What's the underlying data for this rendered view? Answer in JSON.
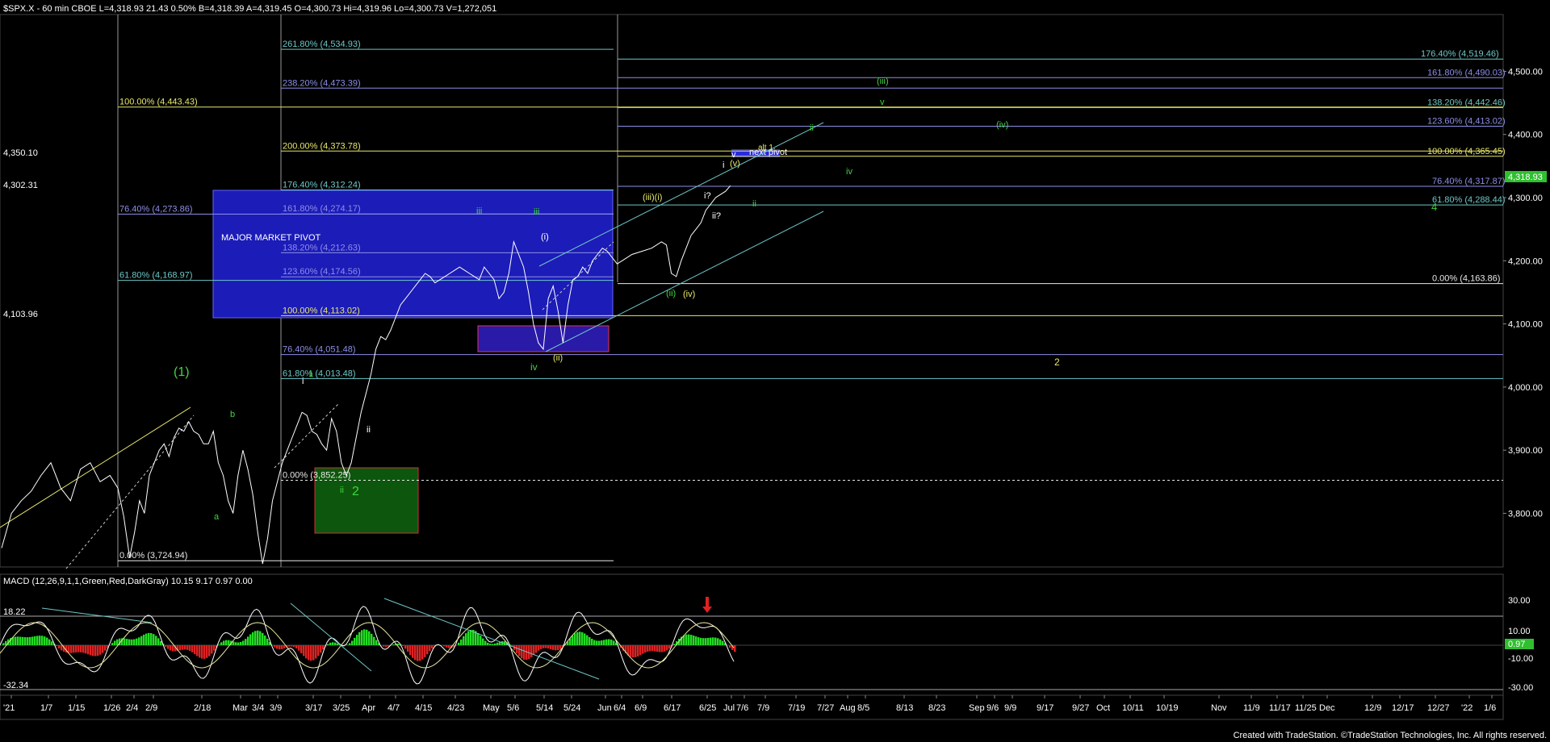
{
  "header": {
    "title": "$SPX.X - 60 min  CBOE  L=4,318.93  21.43  0.50%  B=4,318.39  A=4,319.45  O=4,300.73  Hi=4,319.96  Lo=4,300.73  V=1,272,051"
  },
  "footer": {
    "credit": "Created with TradeStation. ©TradeStation Technologies, Inc. All rights reserved."
  },
  "macd": {
    "header": "MACD (12,26,9,1,1,Green,Red,DarkGray)   10.15   9.17   0.97   0.00",
    "left_top": "18.22",
    "left_bottom": "-32.34",
    "current": "0.97",
    "ticks": [
      "30.00",
      "10.00",
      "-10.00",
      "-30.00"
    ],
    "colors": {
      "positive": "#22dd22",
      "negative": "#dd2222",
      "line": "#ffffff",
      "signal": "#e8e8a0"
    }
  },
  "colors": {
    "background": "#000000",
    "price": "#ffffff",
    "fib_yellow": "#e8e86a",
    "fib_blue": "#8e8ee8",
    "fib_teal": "#6ec7c7",
    "wave_green": "#3fd63f",
    "wave_yellow": "#e8e86a",
    "pivot_box": "#2020c0",
    "support_box": "#0f6a0f",
    "current_price_bg": "#2fbf2f"
  },
  "annotations": {
    "major_pivot": "MAJOR MARKET PIVOT",
    "next_pivot": "next pivot",
    "left_price_a": "4,350.10",
    "left_price_b": "4,302.31",
    "left_price_c": "4,103.96",
    "current_price": "4,318.93"
  },
  "chart_data": {
    "type": "line",
    "title": "$SPX.X - 60 min",
    "xlabel": "",
    "ylabel": "",
    "ylim": [
      3715,
      4590
    ],
    "grid": false,
    "x_ticks": [
      "'21",
      "1/7",
      "1/15",
      "1/26",
      "2/4",
      "2/9",
      "2/18",
      "Mar",
      "3/4",
      "3/9",
      "3/17",
      "3/25",
      "Apr",
      "4/7",
      "4/15",
      "4/23",
      "May",
      "5/6",
      "5/14",
      "5/24",
      "Jun",
      "6/4",
      "6/9",
      "6/17",
      "6/25",
      "Jul",
      "7/6",
      "7/9",
      "7/19",
      "7/27",
      "Aug",
      "8/5",
      "8/13",
      "8/23",
      "Sep",
      "9/6",
      "9/9",
      "9/17",
      "9/27",
      "Oct",
      "10/11",
      "10/19",
      "Nov",
      "11/9",
      "11/17",
      "11/25",
      "Dec",
      "12/9",
      "12/17",
      "12/27",
      "'22",
      "1/6"
    ],
    "y_ticks": [
      "4,500.00",
      "4,400.00",
      "4,300.00",
      "4,200.00",
      "4,100.00",
      "4,000.00",
      "3,900.00",
      "3,800.00"
    ],
    "price_series": {
      "name": "",
      "points": [
        [
          0,
          3745
        ],
        [
          10,
          3800
        ],
        [
          20,
          3820
        ],
        [
          30,
          3835
        ],
        [
          40,
          3860
        ],
        [
          50,
          3880
        ],
        [
          60,
          3840
        ],
        [
          70,
          3820
        ],
        [
          80,
          3870
        ],
        [
          90,
          3880
        ],
        [
          100,
          3850
        ],
        [
          110,
          3860
        ],
        [
          118,
          3840
        ],
        [
          124,
          3795
        ],
        [
          130,
          3730
        ],
        [
          135,
          3770
        ],
        [
          140,
          3820
        ],
        [
          145,
          3800
        ],
        [
          150,
          3860
        ],
        [
          155,
          3880
        ],
        [
          160,
          3900
        ],
        [
          165,
          3910
        ],
        [
          170,
          3890
        ],
        [
          175,
          3920
        ],
        [
          180,
          3935
        ],
        [
          185,
          3930
        ],
        [
          190,
          3945
        ],
        [
          195,
          3930
        ],
        [
          200,
          3925
        ],
        [
          205,
          3910
        ],
        [
          210,
          3910
        ],
        [
          215,
          3930
        ],
        [
          220,
          3880
        ],
        [
          225,
          3860
        ],
        [
          230,
          3820
        ],
        [
          235,
          3800
        ],
        [
          240,
          3860
        ],
        [
          245,
          3900
        ],
        [
          250,
          3870
        ],
        [
          255,
          3830
        ],
        [
          260,
          3770
        ],
        [
          265,
          3720
        ],
        [
          270,
          3760
        ],
        [
          275,
          3820
        ],
        [
          280,
          3850
        ],
        [
          285,
          3880
        ],
        [
          290,
          3900
        ],
        [
          295,
          3920
        ],
        [
          300,
          3940
        ],
        [
          305,
          3960
        ],
        [
          310,
          3955
        ],
        [
          315,
          3930
        ],
        [
          320,
          3925
        ],
        [
          325,
          3910
        ],
        [
          330,
          3900
        ],
        [
          335,
          3950
        ],
        [
          340,
          3930
        ],
        [
          345,
          3880
        ],
        [
          350,
          3860
        ],
        [
          355,
          3880
        ],
        [
          360,
          3920
        ],
        [
          365,
          3960
        ],
        [
          370,
          3990
        ],
        [
          375,
          4020
        ],
        [
          380,
          4060
        ],
        [
          385,
          4080
        ],
        [
          390,
          4075
        ],
        [
          395,
          4090
        ],
        [
          400,
          4110
        ],
        [
          405,
          4130
        ],
        [
          410,
          4140
        ],
        [
          415,
          4150
        ],
        [
          420,
          4160
        ],
        [
          425,
          4170
        ],
        [
          430,
          4180
        ],
        [
          435,
          4175
        ],
        [
          440,
          4165
        ],
        [
          445,
          4170
        ],
        [
          450,
          4175
        ],
        [
          455,
          4180
        ],
        [
          460,
          4185
        ],
        [
          465,
          4190
        ],
        [
          470,
          4185
        ],
        [
          475,
          4180
        ],
        [
          480,
          4175
        ],
        [
          485,
          4170
        ],
        [
          490,
          4190
        ],
        [
          495,
          4180
        ],
        [
          500,
          4170
        ],
        [
          505,
          4140
        ],
        [
          510,
          4150
        ],
        [
          515,
          4180
        ],
        [
          520,
          4230
        ],
        [
          525,
          4210
        ],
        [
          530,
          4190
        ],
        [
          535,
          4150
        ],
        [
          540,
          4100
        ],
        [
          545,
          4070
        ],
        [
          550,
          4060
        ],
        [
          555,
          4140
        ],
        [
          560,
          4160
        ],
        [
          565,
          4120
        ],
        [
          570,
          4070
        ],
        [
          575,
          4130
        ],
        [
          580,
          4170
        ],
        [
          585,
          4175
        ],
        [
          590,
          4190
        ],
        [
          595,
          4180
        ],
        [
          600,
          4200
        ],
        [
          605,
          4210
        ],
        [
          610,
          4220
        ],
        [
          615,
          4215
        ],
        [
          620,
          4205
        ],
        [
          625,
          4195
        ],
        [
          630,
          4200
        ],
        [
          640,
          4210
        ],
        [
          650,
          4215
        ],
        [
          660,
          4220
        ],
        [
          670,
          4230
        ],
        [
          675,
          4225
        ],
        [
          680,
          4180
        ],
        [
          685,
          4175
        ],
        [
          690,
          4200
        ],
        [
          695,
          4220
        ],
        [
          700,
          4240
        ],
        [
          705,
          4250
        ],
        [
          710,
          4260
        ],
        [
          715,
          4280
        ],
        [
          720,
          4290
        ],
        [
          725,
          4300
        ],
        [
          730,
          4305
        ],
        [
          735,
          4310
        ],
        [
          740,
          4319
        ]
      ]
    },
    "fib_levels": [
      {
        "label": "261.80% (4,534.93)",
        "value": 4534.93,
        "color": "#6ec7c7"
      },
      {
        "label": "238.20% (4,473.39)",
        "value": 4473.39,
        "color": "#8e8ee8"
      },
      {
        "label": "100.00% (4,443.43)",
        "value": 4443.43,
        "color": "#e8e86a"
      },
      {
        "label": "200.00% (4,373.78)",
        "value": 4373.78,
        "color": "#e8e86a"
      },
      {
        "label": "176.40% (4,312.24)",
        "value": 4312.24,
        "color": "#6ec7c7"
      },
      {
        "label": "76.40% (4,273.86)",
        "value": 4273.86,
        "color": "#8e8ee8"
      },
      {
        "label": "161.80% (4,274.17)",
        "value": 4274.17,
        "color": "#8e8ee8"
      },
      {
        "label": "138.20% (4,212.63)",
        "value": 4212.63,
        "color": "#8e8ee8"
      },
      {
        "label": "123.60% (4,174.56)",
        "value": 4174.56,
        "color": "#8e8ee8"
      },
      {
        "label": "61.80% (4,168.97)",
        "value": 4168.97,
        "color": "#6ec7c7"
      },
      {
        "label": "100.00% (4,113.02)",
        "value": 4113.02,
        "color": "#e8e86a"
      },
      {
        "label": "76.40% (4,051.48)",
        "value": 4051.48,
        "color": "#8e8ee8"
      },
      {
        "label": "61.80% (4,013.48)",
        "value": 4013.48,
        "color": "#6ec7c7"
      },
      {
        "label": "0.00% (3,852.25)",
        "value": 3852.25,
        "color": "#e8e8e8"
      },
      {
        "label": "0.00% (3,724.94)",
        "value": 3724.94,
        "color": "#e8e8e8"
      },
      {
        "label": "176.40% (4,519.46)",
        "value": 4519.46,
        "color": "#6ec7c7"
      },
      {
        "label": "161.80% (4,490.03)",
        "value": 4490.03,
        "color": "#8e8ee8"
      },
      {
        "label": "138.20% (4,442.46)",
        "value": 4442.46,
        "color": "#6ec7c7"
      },
      {
        "label": "123.60% (4,413.02)",
        "value": 4413.02,
        "color": "#8e8ee8"
      },
      {
        "label": "100.00% (4,365.45)",
        "value": 4365.45,
        "color": "#e8e86a"
      },
      {
        "label": "76.40% (4,317.87)",
        "value": 4317.87,
        "color": "#8e8ee8"
      },
      {
        "label": "61.80% (4,288.44)",
        "value": 4288.44,
        "color": "#6ec7c7"
      },
      {
        "label": "0.00% (4,163.86)",
        "value": 4163.86,
        "color": "#e8e8e8"
      }
    ],
    "wave_labels": [
      {
        "text": "(1)",
        "color": "#3fd63f"
      },
      {
        "text": "b",
        "color": "#3fd63f"
      },
      {
        "text": "a",
        "color": "#3fd63f"
      },
      {
        "text": "i",
        "color": "#ffffff"
      },
      {
        "text": "1",
        "color": "#3fd63f"
      },
      {
        "text": "iii",
        "color": "#3fd63f"
      },
      {
        "text": "ii",
        "color": "#3fd63f"
      },
      {
        "text": "2",
        "color": "#3fd63f"
      },
      {
        "text": "ii",
        "color": "#ffffff"
      },
      {
        "text": "iii",
        "color": "#3fd63f"
      },
      {
        "text": "iv",
        "color": "#3fd63f"
      },
      {
        "text": "(i)",
        "color": "#ffffff"
      },
      {
        "text": "(ii)",
        "color": "#e8e86a"
      },
      {
        "text": "(iii)(i)",
        "color": "#e8e86a"
      },
      {
        "text": "(ii)",
        "color": "#3fd63f"
      },
      {
        "text": "(iv)",
        "color": "#e8e86a"
      },
      {
        "text": "i?",
        "color": "#ffffff"
      },
      {
        "text": "ii?",
        "color": "#ffffff"
      },
      {
        "text": "(v)",
        "color": "#e8e86a"
      },
      {
        "text": "v",
        "color": "#ffffff"
      },
      {
        "text": "alt 1",
        "color": "#e8e86a"
      },
      {
        "text": "i",
        "color": "#ffffff"
      },
      {
        "text": "(iii)",
        "color": "#3fd63f"
      },
      {
        "text": "v",
        "color": "#3fd63f"
      },
      {
        "text": "(iv)",
        "color": "#3fd63f"
      },
      {
        "text": "iv",
        "color": "#3fd63f"
      },
      {
        "text": "ii",
        "color": "#3fd63f"
      },
      {
        "text": "ii",
        "color": "#3fd63f"
      },
      {
        "text": "2",
        "color": "#e8e86a"
      },
      {
        "text": "4",
        "color": "#3fd63f"
      }
    ]
  }
}
